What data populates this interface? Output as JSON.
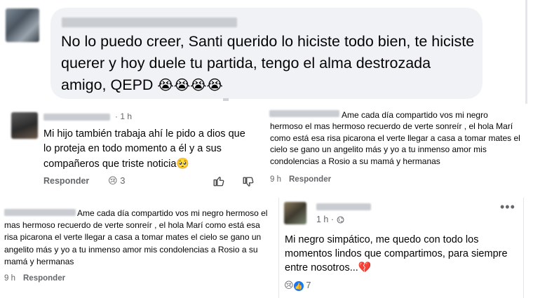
{
  "comment1": {
    "text": "No lo puedo creer, Santi querido lo hiciste todo bien, te hiciste querer y hoy duele tu partida, tengo el alma destrozada amigo, QEPD ",
    "emojis": "😭😭😭😭"
  },
  "comment2": {
    "time": "· 1 h",
    "text": "Mi hijo también trabaja ahí le pido a dios que lo proteja en todo momento a él y a sus compañeros que triste noticia",
    "emoji_end": "🥺",
    "reply_label": "Responder",
    "reaction_emoji": "😢",
    "reaction_count": "3",
    "like_icon": "thumbs-up-icon",
    "dislike_icon": "thumbs-down-icon"
  },
  "comment3": {
    "text": "Ame cada día compartido vos mi negro hermoso el mas hermoso recuerdo de verte sonreír , el hola Marí como está esa risa picarona el verte llegar a casa a tomar mates el cielo se gano un angelito más y yo a tu inmenso amor mis condolencias a Rosio a su mamá y hermanas",
    "time": "9 h",
    "reply_label": "Responder"
  },
  "comment4": {
    "text": "Ame cada día compartido vos mi negro hermoso el mas hermoso recuerdo de verte sonreír , el hola Marí como está esa risa picarona el verte llegar a casa a tomar mates el cielo se gano un angelito más y yo a tu inmenso amor mis condolencias a Rosio a su mamá y hermanas",
    "time": "9 h",
    "reply_label": "Responder"
  },
  "comment5": {
    "time": "1 h ·",
    "globe_icon": "globe-icon",
    "more_label": "•••",
    "text": "Mi negro simpático, me quedo con todo los momentos lindos que compartimos, para siempre entre nosotros...",
    "emoji_end": "💔",
    "reaction_emoji": "😢",
    "reaction_count": "7"
  }
}
